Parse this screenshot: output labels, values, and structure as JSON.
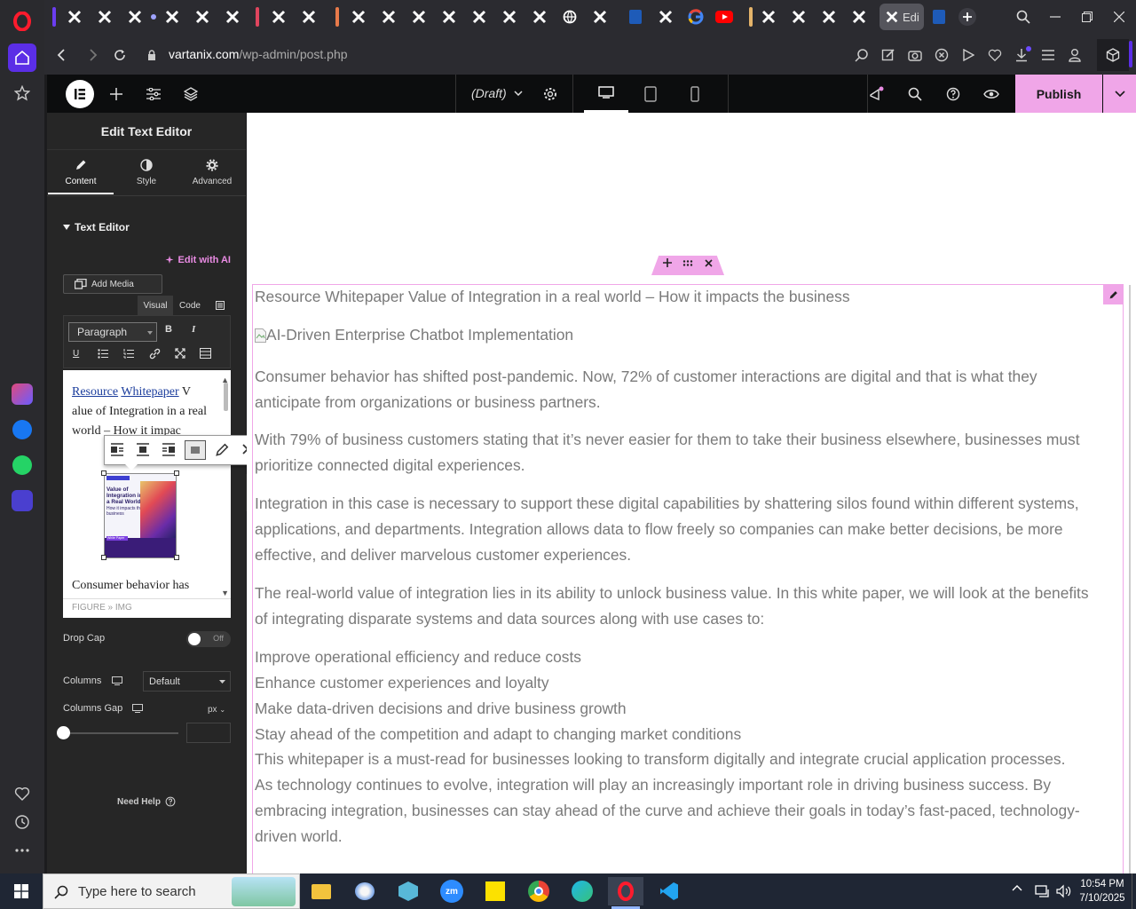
{
  "colors": {
    "accent_pink": "#f0a6e8",
    "elementor_pink": "#e98be3",
    "opera_red": "#ff1b2d",
    "panel_bg": "#262626"
  },
  "browser": {
    "url_domain": "vartanix.com",
    "url_path": "/wp-admin/post.php",
    "active_tab_label": "Edi"
  },
  "editor_topbar": {
    "status": "(Draft)",
    "publish_label": "Publish"
  },
  "panel": {
    "title": "Edit Text Editor",
    "tabs": [
      {
        "label": "Content",
        "icon": "pencil-icon"
      },
      {
        "label": "Style",
        "icon": "contrast-icon"
      },
      {
        "label": "Advanced",
        "icon": "gear-icon"
      }
    ],
    "section_title": "Text Editor",
    "edit_with_ai": "Edit with AI",
    "add_media": "Add Media",
    "mode_visual": "Visual",
    "mode_code": "Code",
    "format_select": "Paragraph",
    "editor_link1": "Resource",
    "editor_link2": "Whitepaper",
    "editor_text1": "V alue of Integration in a real world – How it impac",
    "editor_text2": "Consumer behavior has",
    "editor_path": "FIGURE » IMG",
    "thumb_title": "Value of Integration in a Real World",
    "thumb_sub": "How it impacts the business",
    "thumb_btn": "White Paper",
    "drop_cap_label": "Drop Cap",
    "drop_cap_state": "Off",
    "columns_label": "Columns",
    "columns_value": "Default",
    "columns_gap_label": "Columns Gap",
    "columns_gap_unit": "px",
    "need_help": "Need Help"
  },
  "canvas": {
    "heading_line": "Resource Whitepaper Value of Integration in a real world – How it impacts the business",
    "image_alt": "AI-Driven Enterprise Chatbot Implementation",
    "para1_l1": "Consumer behavior has shifted post-pandemic. Now, 72% of customer interactions are digital and that is what they",
    "para1_l2": "anticipate from organizations or business partners.",
    "para2_l1": "With 79% of business customers stating that it’s never easier for them to take their business elsewhere, businesses must",
    "para2_l2": "prioritize connected digital experiences.",
    "para3_l1": "Integration in this case is necessary to support these digital capabilities by shattering silos found within different systems,",
    "para3_l2": "applications, and departments. Integration allows data to flow freely so companies can make better decisions, be more",
    "para3_l3": "effective, and deliver marvelous customer experiences.",
    "para4_l1": "The real-world value of integration lies in its ability to unlock business value. In this white paper, we will look at the benefits",
    "para4_l2": "of integrating disparate systems and data sources along with use cases to:",
    "list": [
      "Improve operational efficiency and reduce costs",
      "Enhance customer experiences and loyalty",
      "Make data-driven decisions and drive business growth",
      "Stay ahead of the competition and adapt to changing market conditions"
    ],
    "para5_l1": "This whitepaper is a must-read for businesses looking to transform digitally and integrate crucial application processes.",
    "para5_l2": "As technology continues to evolve, integration will play an increasingly important role in driving business success. By",
    "para5_l3": "embracing integration, businesses can stay ahead of the curve and achieve their goals in today’s fast-paced, technology-",
    "para5_l4": "driven world."
  },
  "taskbar": {
    "search_placeholder": "Type here to search",
    "time": "10:54 PM",
    "date": "7/10/2025"
  }
}
